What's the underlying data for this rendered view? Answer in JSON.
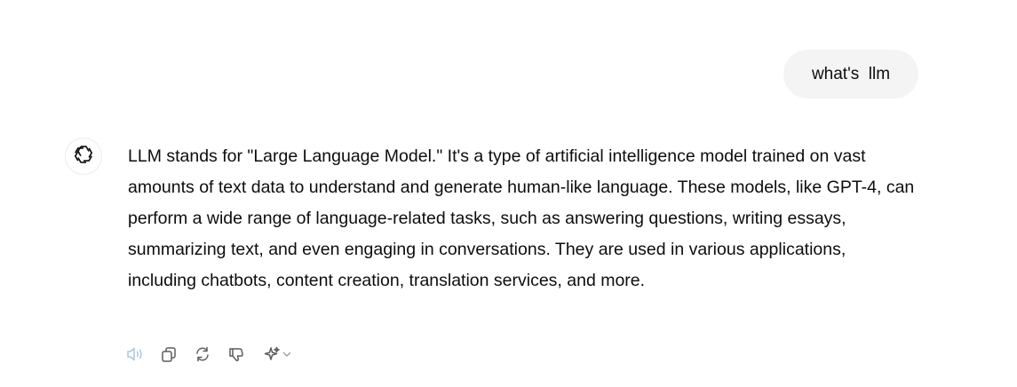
{
  "user_message": {
    "text": "what's  llm"
  },
  "assistant": {
    "avatar_icon": "openai-logo-icon",
    "message": "LLM stands for \"Large Language Model.\" It's a type of artificial intelligence model trained on vast amounts of text data to understand and generate human-like language. These models, like GPT-4, can perform a wide range of language-related tasks, such as answering questions, writing essays, summarizing text, and even engaging in conversations. They are used in various applications, including chatbots, content creation, translation services, and more."
  },
  "actions": [
    {
      "icon": "speaker-icon",
      "state": "active"
    },
    {
      "icon": "copy-icon"
    },
    {
      "icon": "regenerate-icon"
    },
    {
      "icon": "thumbs-down-icon"
    },
    {
      "icon": "sparkle-icon",
      "has_dropdown": true
    }
  ],
  "colors": {
    "bubble_bg": "#f4f4f4",
    "text": "#0d0d0d",
    "icon_muted": "#5d5d5d",
    "icon_active": "#a8c8e8"
  }
}
